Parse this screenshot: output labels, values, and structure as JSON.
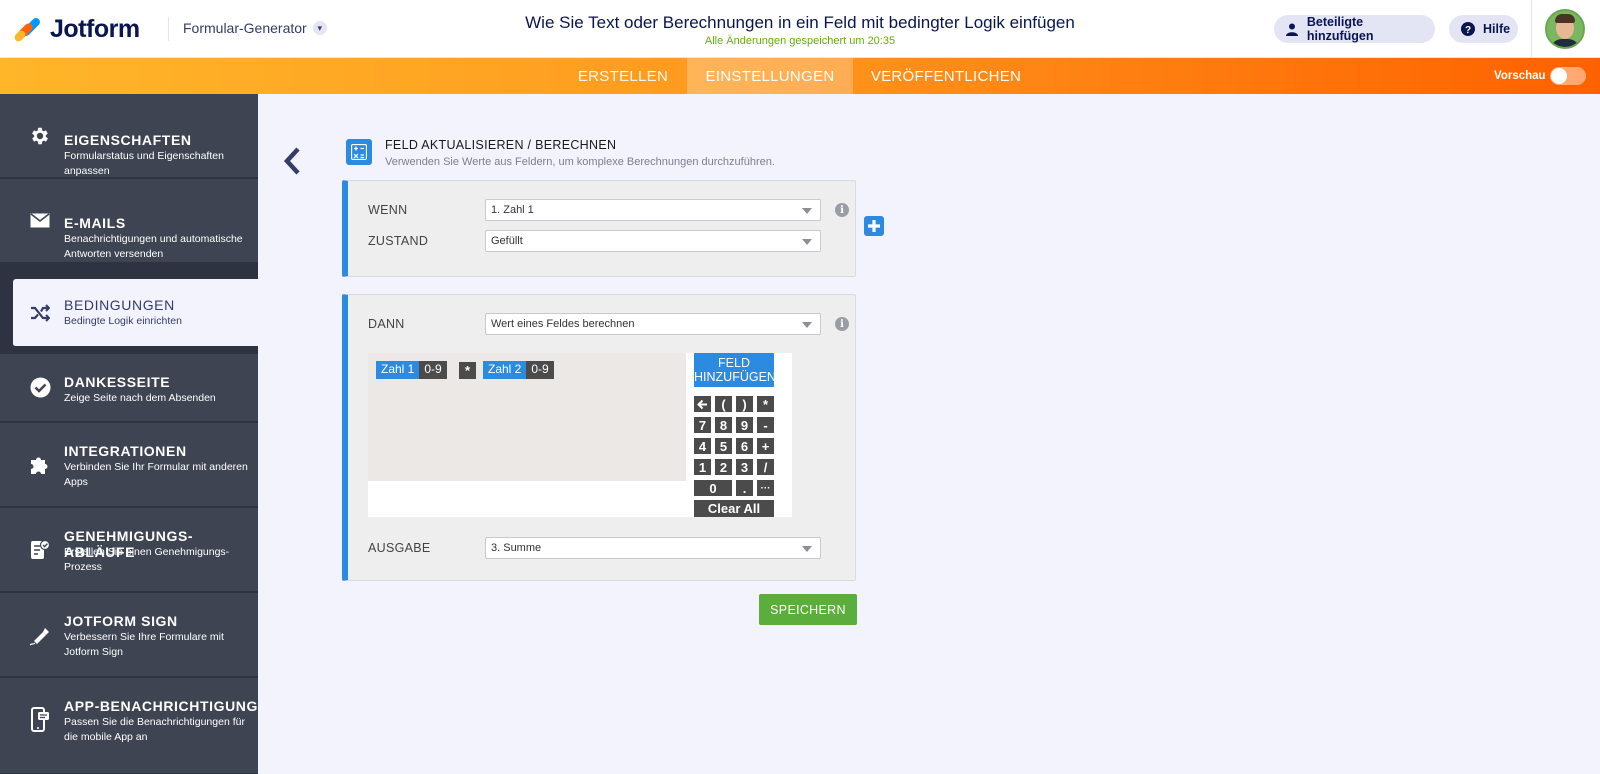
{
  "header": {
    "logo_text": "Jotform",
    "builder_label": "Formular-Generator",
    "doc_title": "Wie Sie Text oder Berechnungen in ein Feld mit bedingter Logik einfügen",
    "saved_status": "Alle Änderungen gespeichert um 20:35",
    "invite_label": "Beteiligte hinzufügen",
    "help_label": "Hilfe"
  },
  "nav": {
    "tabs": [
      {
        "label": "ERSTELLEN"
      },
      {
        "label": "EINSTELLUNGEN"
      },
      {
        "label": "VERÖFFENTLICHEN"
      }
    ],
    "preview_label": "Vorschau"
  },
  "sidebar": {
    "items": [
      {
        "title": "EIGENSCHAFTEN",
        "desc": "Formularstatus und Eigenschaften anpassen",
        "icon": "gear-icon"
      },
      {
        "title": "E-MAILS",
        "desc": "Benachrichtigungen und automatische Antworten versenden",
        "icon": "mail-icon"
      },
      {
        "title": "BEDINGUNGEN",
        "desc": "Bedingte Logik einrichten",
        "icon": "shuffle-icon"
      },
      {
        "title": "DANKESSEITE",
        "desc": "Zeige Seite nach dem Absenden",
        "icon": "check-circle-icon"
      },
      {
        "title": "INTEGRATIONEN",
        "desc": "Verbinden Sie Ihr Formular mit anderen Apps",
        "icon": "puzzle-icon"
      },
      {
        "title": "GENEHMIGUNGS-ABLÄUFE",
        "desc": "Erstellen Sie einen Genehmigungs-Prozess",
        "icon": "approval-icon"
      },
      {
        "title": "JOTFORM SIGN",
        "desc": "Verbessern Sie Ihre Formulare mit Jotform Sign",
        "icon": "pen-icon"
      },
      {
        "title": "APP-BENACHRICHTIGUNG",
        "desc": "Passen Sie die Benachrichtigungen für die mobile App an",
        "icon": "mobile-icon"
      }
    ]
  },
  "panel": {
    "title": "FELD AKTUALISIEREN / BERECHNEN",
    "subtitle": "Verwenden Sie Werte aus Feldern, um komplexe Berechnungen durchzuführen."
  },
  "condition": {
    "if_label": "WENN",
    "if_value": "1. Zahl 1",
    "state_label": "ZUSTAND",
    "state_value": "Gefüllt"
  },
  "action": {
    "then_label": "DANN",
    "then_value": "Wert eines Feldes berechnen",
    "output_label": "AUSGABE",
    "output_value": "3. Summe"
  },
  "formula": {
    "field1_name": "Zahl 1",
    "field1_type": "0-9",
    "operator": "*",
    "field2_name": "Zahl 2",
    "field2_type": "0-9"
  },
  "calculator": {
    "add_field_label": "FELD HINZUFÜGEN",
    "keys": [
      "(",
      ")",
      "*",
      "7",
      "8",
      "9",
      "-",
      "4",
      "5",
      "6",
      "+",
      "1",
      "2",
      "3",
      "/",
      "0",
      ".",
      "···"
    ],
    "clear_label": "Clear All"
  },
  "save_label": "SPEICHERN",
  "colors": {
    "accent_blue": "#2c8be0",
    "orange_start": "#ffb629",
    "orange_end": "#ff6100",
    "save_green": "#5bae3c",
    "sidebar_dark": "#3e4451"
  }
}
